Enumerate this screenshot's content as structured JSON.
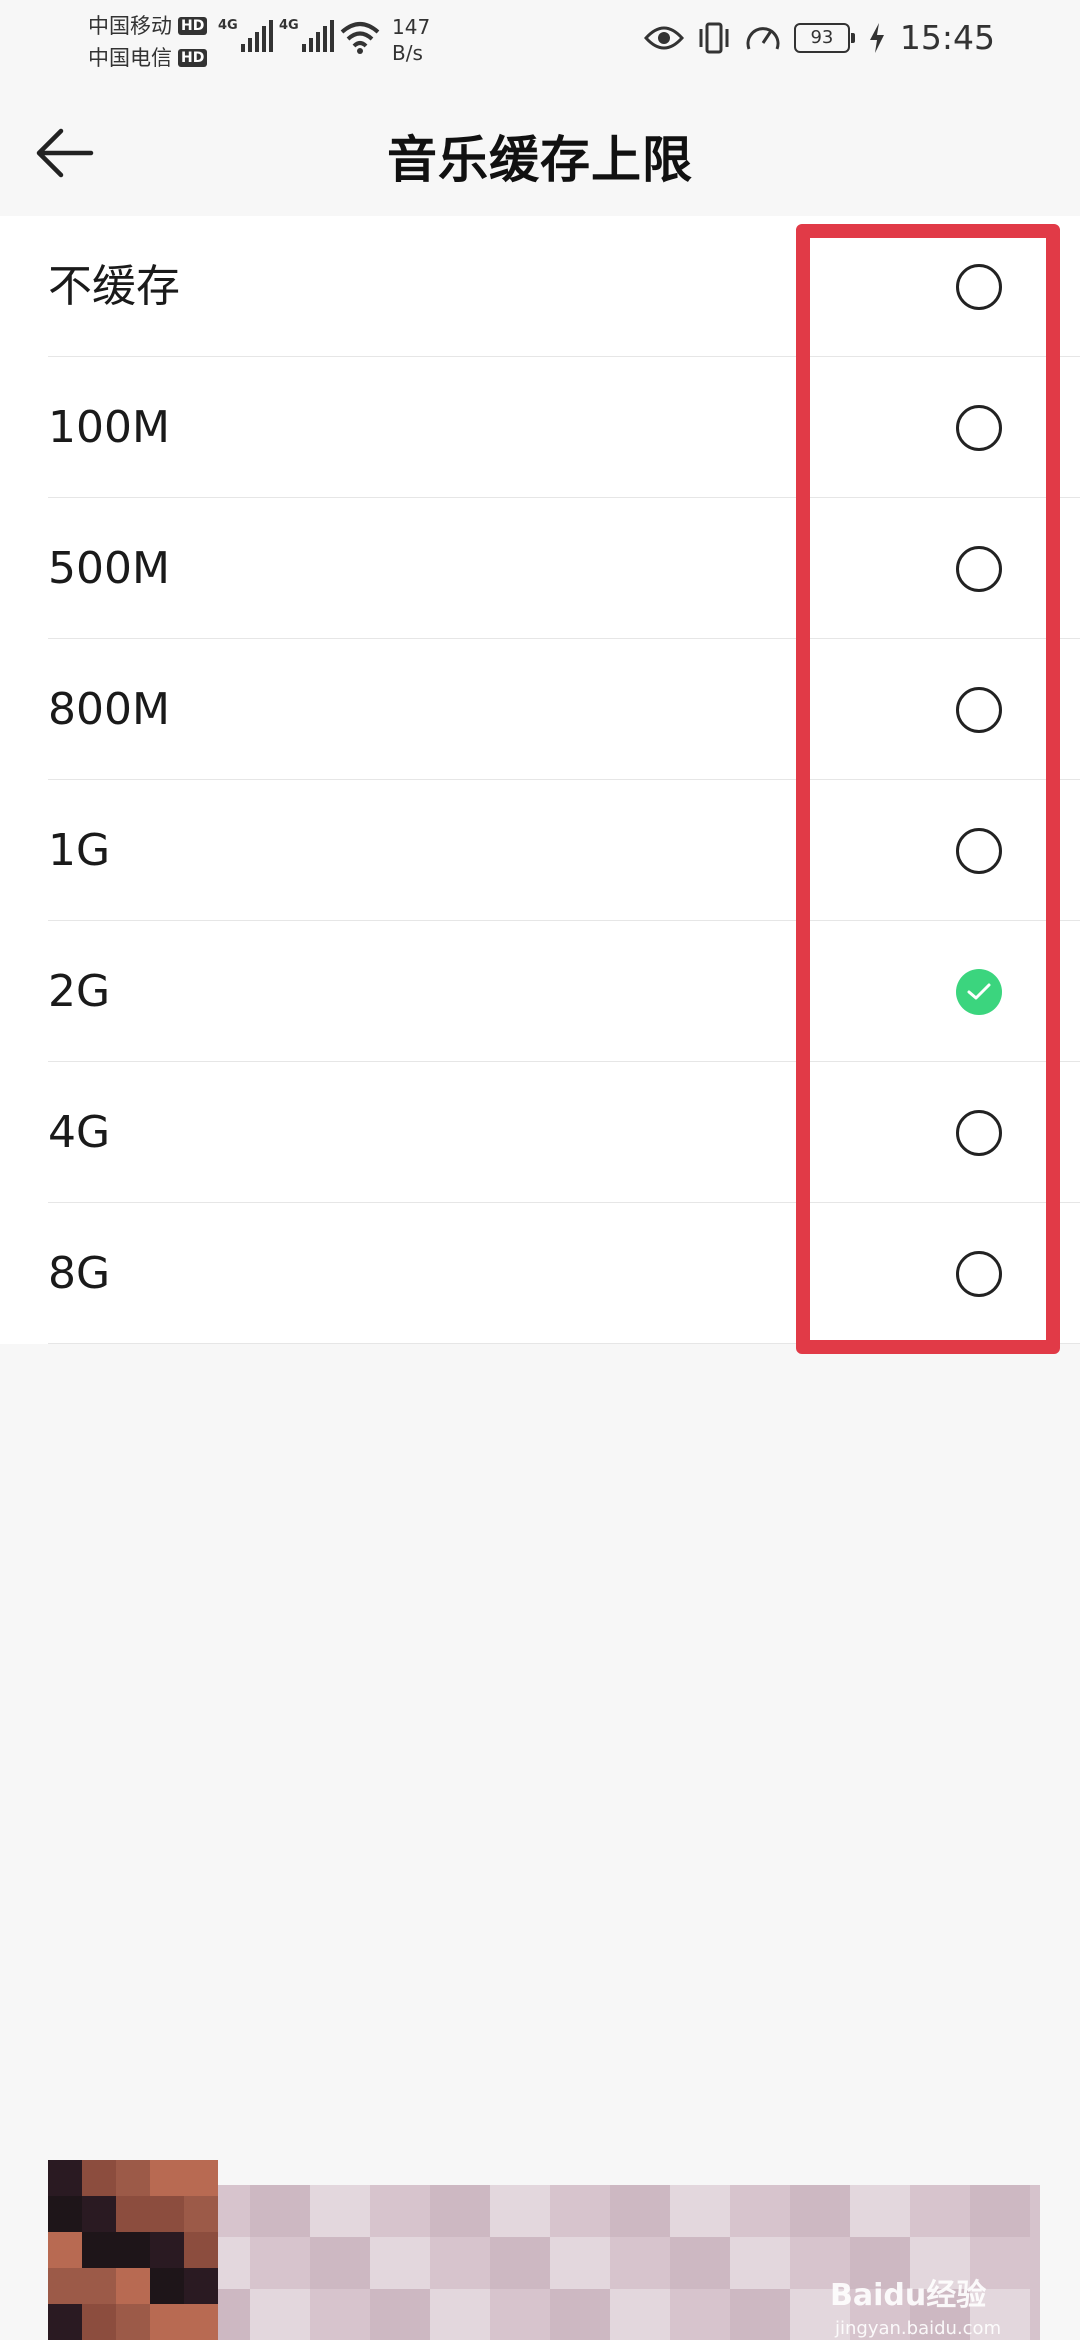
{
  "status_bar": {
    "carrier1": "中国移动",
    "carrier2": "中国电信",
    "hd": "HD",
    "net1": "4G",
    "net2": "4G",
    "speed_value": "147",
    "speed_unit": "B/s",
    "battery": "93",
    "time": "15:45",
    "icons": [
      "eye-icon",
      "vibrate-icon",
      "speedometer-icon",
      "charging-icon",
      "wifi-icon"
    ]
  },
  "header": {
    "back_icon": "back-arrow-icon",
    "title": "音乐缓存上限"
  },
  "options": [
    {
      "label": "不缓存",
      "selected": false
    },
    {
      "label": "100M",
      "selected": false
    },
    {
      "label": "500M",
      "selected": false
    },
    {
      "label": "800M",
      "selected": false
    },
    {
      "label": "1G",
      "selected": false
    },
    {
      "label": "2G",
      "selected": true
    },
    {
      "label": "4G",
      "selected": false
    },
    {
      "label": "8G",
      "selected": false
    }
  ],
  "colors": {
    "accent_check": "#3bd57e",
    "highlight": "#e13a47",
    "background": "#f7f7f7"
  },
  "watermark": {
    "text": "Baidu经验",
    "sub": "jingyan.baidu.com"
  }
}
